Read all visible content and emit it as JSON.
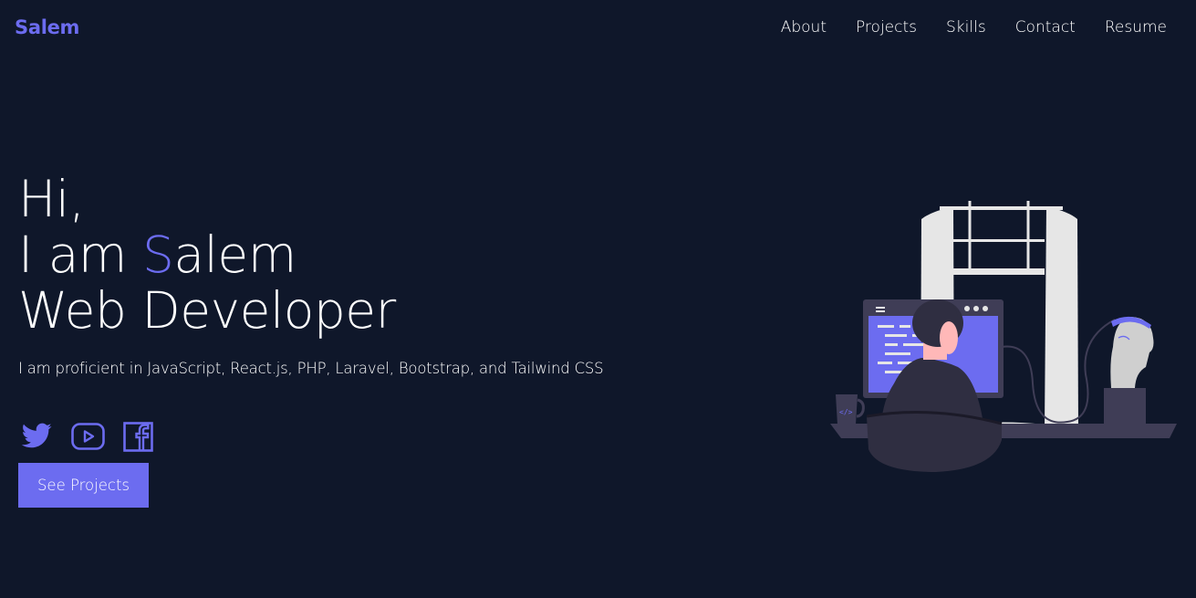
{
  "nav": {
    "brand": "Salem",
    "links": [
      {
        "label": "About"
      },
      {
        "label": "Projects"
      },
      {
        "label": "Skills"
      },
      {
        "label": "Contact"
      },
      {
        "label": "Resume"
      }
    ]
  },
  "hero": {
    "greeting": "Hi,",
    "intro_prefix": "I am ",
    "intro_accent": "S",
    "intro_rest": "alem",
    "role": "Web Developer",
    "tagline": "I am proficient in JavaScript, React.js, PHP, Laravel, Bootstrap, and Tailwind CSS",
    "cta_label": "See Projects"
  },
  "socials": [
    {
      "icon": "twitter-icon"
    },
    {
      "icon": "youtube-icon"
    },
    {
      "icon": "facebook-icon"
    }
  ],
  "colors": {
    "background": "#0f172a",
    "accent": "#6c6cf0",
    "text": "#ffffff"
  }
}
